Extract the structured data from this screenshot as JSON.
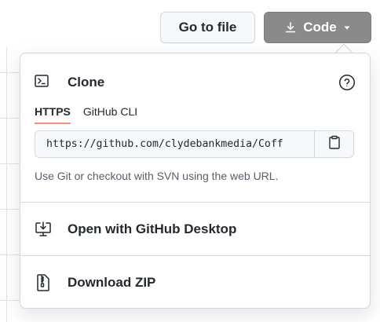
{
  "toolbar": {
    "goto_label": "Go to file",
    "code_label": "Code"
  },
  "clone": {
    "title": "Clone",
    "tabs": [
      {
        "label": "HTTPS",
        "active": true
      },
      {
        "label": "GitHub CLI",
        "active": false
      }
    ],
    "url_value": "https://github.com/clydebankmedia/Coff",
    "hint": "Use Git or checkout with SVN using the web URL."
  },
  "actions": {
    "desktop_label": "Open with GitHub Desktop",
    "zip_label": "Download ZIP"
  },
  "icons": {
    "terminal": "terminal-icon",
    "help": "question-icon",
    "copy": "clipboard-icon",
    "download": "download-icon",
    "caret": "triangle-down-icon",
    "desktop": "desktop-download-icon",
    "zip": "file-zip-icon"
  },
  "colors": {
    "code_button": "#8a8a8a",
    "tab_underline": "#fd8c73",
    "border": "#d0d7de"
  }
}
